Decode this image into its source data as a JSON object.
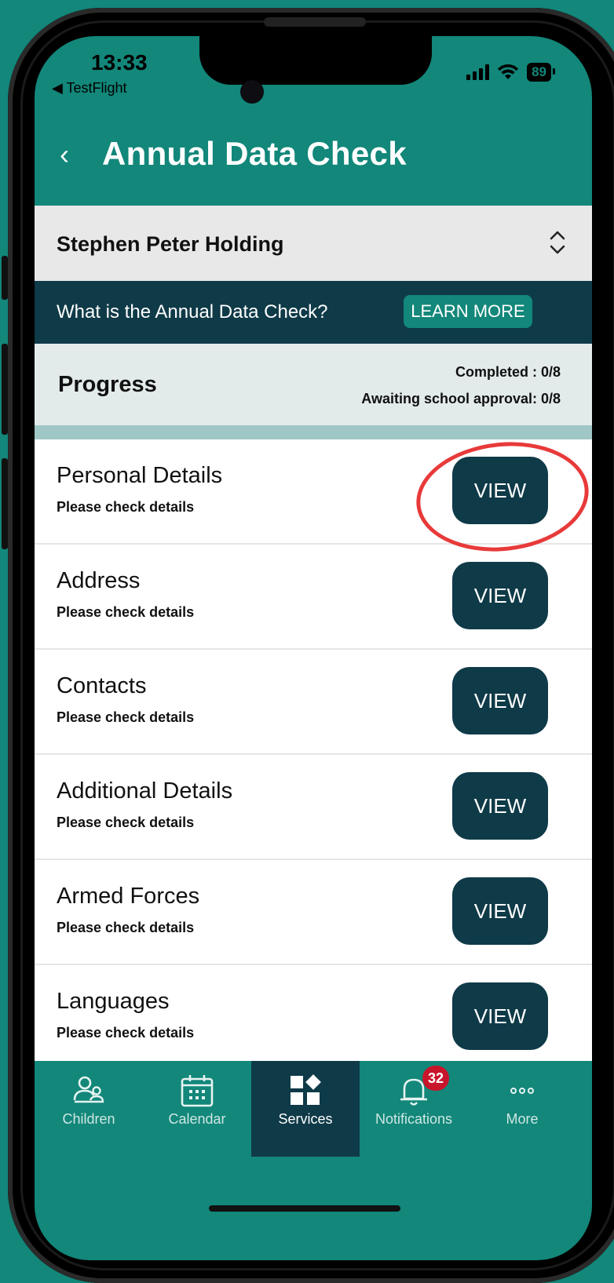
{
  "status_bar": {
    "time": "13:33",
    "back_app": "◀ TestFlight",
    "battery": "89"
  },
  "header": {
    "title": "Annual Data Check"
  },
  "child_selector": {
    "name": "Stephen Peter Holding"
  },
  "info_bar": {
    "text": "What is the Annual Data Check?",
    "learn_more": "LEARN MORE"
  },
  "progress": {
    "title": "Progress",
    "completed": "Completed : 0/8",
    "awaiting": "Awaiting school approval: 0/8"
  },
  "sections": [
    {
      "title": "Personal Details",
      "subtitle": "Please check details",
      "button": "VIEW"
    },
    {
      "title": "Address",
      "subtitle": "Please check details",
      "button": "VIEW"
    },
    {
      "title": "Contacts",
      "subtitle": "Please check details",
      "button": "VIEW"
    },
    {
      "title": "Additional Details",
      "subtitle": "Please check details",
      "button": "VIEW"
    },
    {
      "title": "Armed Forces",
      "subtitle": "Please check details",
      "button": "VIEW"
    },
    {
      "title": "Languages",
      "subtitle": "Please check details",
      "button": "VIEW"
    }
  ],
  "tabbar": {
    "tabs": [
      {
        "label": "Children",
        "icon": "children-icon"
      },
      {
        "label": "Calendar",
        "icon": "calendar-icon"
      },
      {
        "label": "Services",
        "icon": "services-icon",
        "active": true
      },
      {
        "label": "Notifications",
        "icon": "bell-icon",
        "badge": "32"
      },
      {
        "label": "More",
        "icon": "more-icon"
      }
    ]
  },
  "colors": {
    "teal": "#12877a",
    "dark_navy": "#0f3a48",
    "highlight_red": "#e83a3a",
    "badge_red": "#c8152c"
  }
}
